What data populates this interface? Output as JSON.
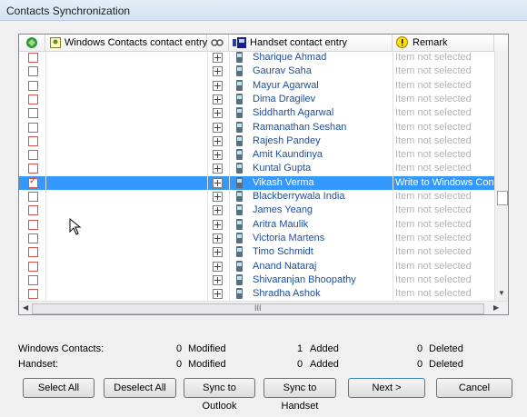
{
  "window": {
    "title": "Contacts Synchronization"
  },
  "grid": {
    "headers": {
      "windows_entry": "Windows Contacts contact entry",
      "handset_entry": "Handset contact entry",
      "remark": "Remark"
    },
    "rows": [
      {
        "checked": false,
        "name": "Sharique Ahmad",
        "remark": "Item not selected",
        "selected": false
      },
      {
        "checked": false,
        "name": "Gaurav Saha",
        "remark": "Item not selected",
        "selected": false
      },
      {
        "checked": false,
        "name": "Mayur Agarwal",
        "remark": "Item not selected",
        "selected": false
      },
      {
        "checked": false,
        "name": "Dima Dragilev",
        "remark": "Item not selected",
        "selected": false
      },
      {
        "checked": false,
        "name": "Siddharth Agarwal",
        "remark": "Item not selected",
        "selected": false
      },
      {
        "checked": false,
        "name": "Ramanathan Seshan",
        "remark": "Item not selected",
        "selected": false
      },
      {
        "checked": false,
        "name": "Rajesh Pandey",
        "remark": "Item not selected",
        "selected": false
      },
      {
        "checked": false,
        "name": "Amit Kaundinya",
        "remark": "Item not selected",
        "selected": false
      },
      {
        "checked": false,
        "name": "Kuntal Gupta",
        "remark": "Item not selected",
        "selected": false
      },
      {
        "checked": true,
        "name": "Vikash Verma",
        "remark": "Write to Windows Con",
        "selected": true
      },
      {
        "checked": false,
        "name": "Blackberrywala India",
        "remark": "Item not selected",
        "selected": false
      },
      {
        "checked": false,
        "name": "James Yeang",
        "remark": "Item not selected",
        "selected": false
      },
      {
        "checked": false,
        "name": "Aritra Maulik",
        "remark": "Item not selected",
        "selected": false
      },
      {
        "checked": false,
        "name": "Victoria Martens",
        "remark": "Item not selected",
        "selected": false
      },
      {
        "checked": false,
        "name": "Timo Schmidt",
        "remark": "Item not selected",
        "selected": false
      },
      {
        "checked": false,
        "name": "Anand Nataraj",
        "remark": "Item not selected",
        "selected": false
      },
      {
        "checked": false,
        "name": "Shivaranjan Bhoopathy",
        "remark": "Item not selected",
        "selected": false
      },
      {
        "checked": false,
        "name": "Shradha Ashok",
        "remark": "Item not selected",
        "selected": false
      }
    ],
    "hscroll_grip": "III"
  },
  "summary": {
    "windows": {
      "label": "Windows Contacts:",
      "modified_count": "0",
      "modified_label": "Modified",
      "added_count": "1",
      "added_label": "Added",
      "deleted_count": "0",
      "deleted_label": "Deleted"
    },
    "handset": {
      "label": "Handset:",
      "modified_count": "0",
      "modified_label": "Modified",
      "added_count": "0",
      "added_label": "Added",
      "deleted_count": "0",
      "deleted_label": "Deleted"
    }
  },
  "buttons": {
    "select_all": "Select All",
    "deselect_all": "Deselect All",
    "sync_outlook": "Sync to Outlook",
    "sync_handset": "Sync to Handset",
    "next": "Next >",
    "cancel": "Cancel"
  },
  "colors": {
    "selection": "#3399ff",
    "name_text": "#1f4e99",
    "remark_text": "#b3b3b3",
    "checkbox_border": "#d9534f"
  }
}
